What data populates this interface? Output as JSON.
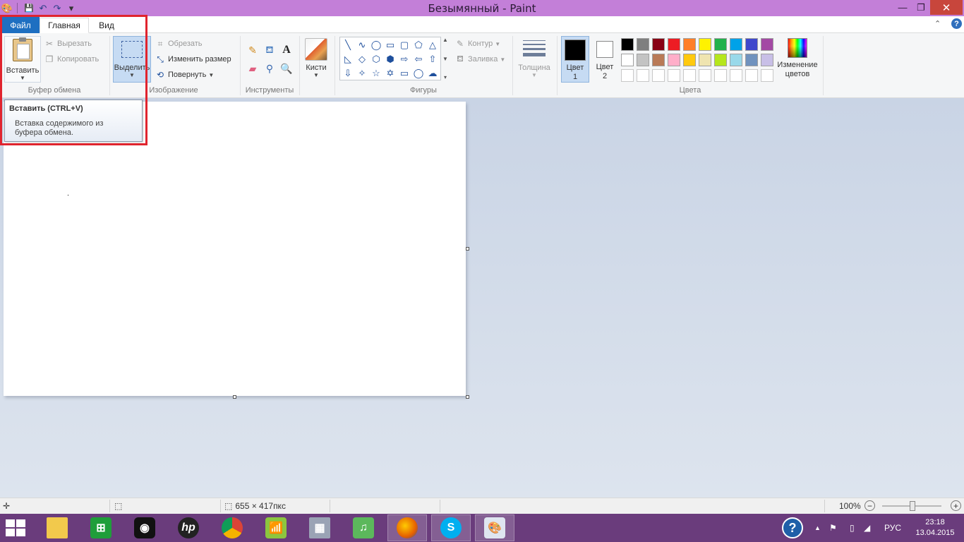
{
  "window": {
    "title": "Безымянный - Paint",
    "minimize_icon": "minimize-icon",
    "maximize_icon": "restore-icon",
    "close_icon": "close-icon",
    "min_glyph": "—",
    "max_glyph": "❐",
    "close_glyph": "✕"
  },
  "quick_access": {
    "save_glyph": "💾",
    "undo_glyph": "↶",
    "redo_glyph": "↷",
    "customize_glyph": "▾"
  },
  "tabs": {
    "file": "Файл",
    "home": "Главная",
    "view": "Вид",
    "collapse_glyph": "⌃",
    "help_glyph": "?"
  },
  "clipboard": {
    "label": "Буфер обмена",
    "paste": "Вставить",
    "cut": "Вырезать",
    "copy": "Копировать"
  },
  "image": {
    "label": "Изображение",
    "select": "Выделить",
    "crop": "Обрезать",
    "resize": "Изменить размер",
    "rotate": "Повернуть"
  },
  "tools": {
    "label": "Инструменты",
    "text_glyph": "A"
  },
  "brushes": {
    "label": "Кисти"
  },
  "shapes": {
    "label": "Фигуры",
    "outline": "Контур",
    "fill": "Заливка",
    "items": [
      "╲",
      "∿",
      "◯",
      "▭",
      "▢",
      "⬠",
      "△",
      "◺",
      "◇",
      "⬡",
      "⬢",
      "⇨",
      "⇦",
      "⇧",
      "⇩",
      "✧",
      "☆",
      "✡",
      "💬",
      "🗨",
      "💭"
    ]
  },
  "size": {
    "label": "Толщина"
  },
  "colors": {
    "label": "Цвета",
    "color1_line1": "Цвет",
    "color1_line2": "1",
    "color2_line1": "Цвет",
    "color2_line2": "2",
    "color1_value": "#000000",
    "color2_value": "#ffffff",
    "edit_line1": "Изменение",
    "edit_line2": "цветов",
    "palette_row1": [
      "#000000",
      "#7f7f7f",
      "#880015",
      "#ed1c24",
      "#ff7f27",
      "#fff200",
      "#22b14c",
      "#00a2e8",
      "#3f48cc",
      "#a349a4"
    ],
    "palette_row2": [
      "#ffffff",
      "#c3c3c3",
      "#b97a57",
      "#ffaec9",
      "#ffc90e",
      "#efe4b0",
      "#b5e61d",
      "#99d9ea",
      "#7092be",
      "#c8bfe7"
    ],
    "palette_row3": [
      "#ffffff",
      "#ffffff",
      "#ffffff",
      "#ffffff",
      "#ffffff",
      "#ffffff",
      "#ffffff",
      "#ffffff",
      "#ffffff",
      "#ffffff"
    ]
  },
  "tooltip": {
    "title": "Вставить (CTRL+V)",
    "body": "Вставка содержимого из буфера обмена."
  },
  "statusbar": {
    "image_size": "655 × 417пкс",
    "zoom": "100%",
    "zoom_out": "−",
    "zoom_in": "+"
  },
  "taskbar": {
    "time": "23:18",
    "date": "13.04.2015",
    "language": "РУС",
    "apps": [
      "file-explorer",
      "store",
      "webcam",
      "hp",
      "chrome",
      "wifi-manager",
      "calculator",
      "music",
      "firefox",
      "skype",
      "paint"
    ],
    "hp_text": "hp",
    "help_glyph": "?"
  }
}
